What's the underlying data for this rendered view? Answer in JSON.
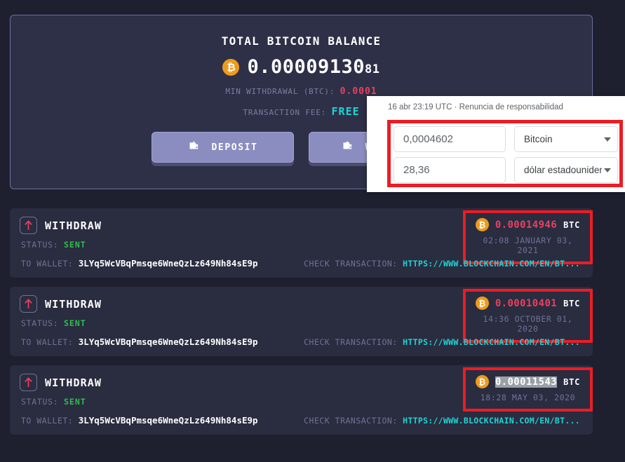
{
  "balance_panel": {
    "title": "Total Bitcoin balance",
    "coin_icon": "bitcoin-icon",
    "amount_main": "0.00009130",
    "amount_fraction": "81",
    "min_withdrawal_label": "Min withdrawal (BTC):",
    "min_withdrawal_value": "0.0001",
    "transaction_fee_label": "Transaction fee:",
    "transaction_fee_value": "FREE",
    "buttons": [
      {
        "label": "Deposit",
        "icon": "tray-download-icon"
      },
      {
        "label": "Withdraw",
        "icon": "tray-upload-icon"
      }
    ]
  },
  "converter_popup": {
    "header": "16 abr 23:19 UTC · Renuncia de responsabilidad",
    "from_value": "0,0004602",
    "from_currency": "Bitcoin",
    "to_value": "28,36",
    "to_currency": "dólar estadounidense",
    "caret_icon": "chevron-down-icon"
  },
  "transactions": [
    {
      "type": "Withdraw",
      "icon": "arrow-up-icon",
      "status_label": "Status:",
      "status_value": "Sent",
      "wallet_label": "To wallet:",
      "wallet_address": "3LYq5WcVBqPmsqe6WneQzLz649Nh84sE9p",
      "check_label": "Check transaction:",
      "check_url": "HTTPS://WWW.BLOCKCHAIN.COM/EN/BT...",
      "amount": "0.00014946",
      "unit": "BTC",
      "date": "02:08 January 03, 2021",
      "selected": false
    },
    {
      "type": "Withdraw",
      "icon": "arrow-up-icon",
      "status_label": "Status:",
      "status_value": "Sent",
      "wallet_label": "To wallet:",
      "wallet_address": "3LYq5WcVBqPmsqe6WneQzLz649Nh84sE9p",
      "check_label": "Check transaction:",
      "check_url": "HTTPS://WWW.BLOCKCHAIN.COM/EN/BT...",
      "amount": "0.00010401",
      "unit": "BTC",
      "date": "14:36 October 01, 2020",
      "selected": false
    },
    {
      "type": "Withdraw",
      "icon": "arrow-up-icon",
      "status_label": "Status:",
      "status_value": "Sent",
      "wallet_label": "To wallet:",
      "wallet_address": "3LYq5WcVBqPmsqe6WneQzLz649Nh84sE9p",
      "check_label": "Check transaction:",
      "check_url": "HTTPS://WWW.BLOCKCHAIN.COM/EN/BT...",
      "amount": "0.00011543",
      "unit": "BTC",
      "date": "18:28 May 03, 2020",
      "selected": true
    }
  ],
  "colors": {
    "page_bg": "#1e2030",
    "panel_bg": "#2e3048",
    "card_bg": "#2a2c40",
    "accent_btn": "#8b8cc0",
    "bitcoin_orange": "#ee9b1c",
    "amount_red": "#e8415f",
    "status_green": "#2fbf4f",
    "link_cyan": "#1fd4d4",
    "annotation_red": "#ed1c24",
    "muted_text": "#6f7396"
  }
}
